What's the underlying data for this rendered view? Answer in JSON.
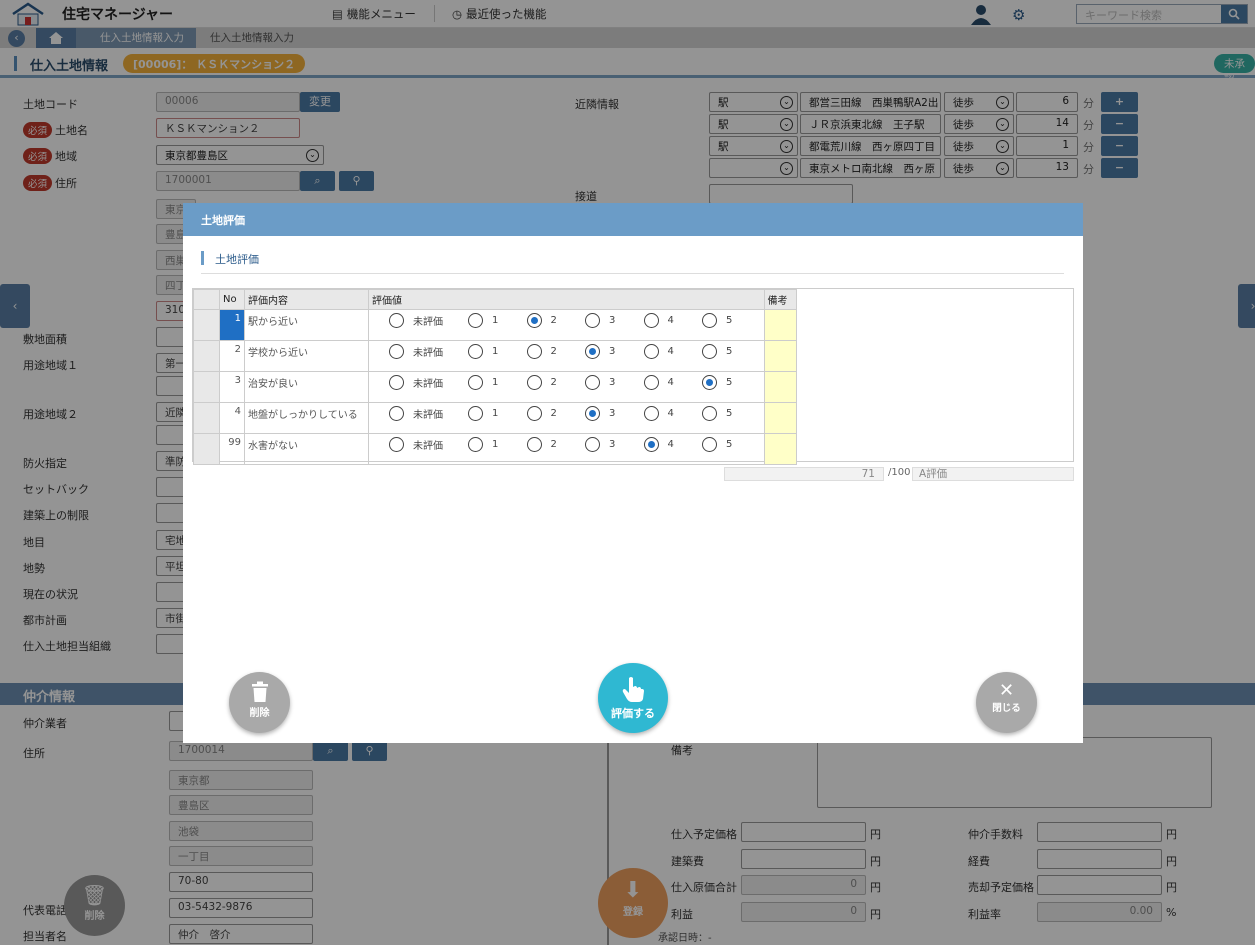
{
  "app": {
    "title": "住宅マネージャー",
    "menu_label": "機能メニュー",
    "recent_label": "最近使った機能",
    "search_placeholder": "キーワード検索"
  },
  "breadcrumb": {
    "items": [
      "仕入土地情報入力",
      "仕入土地情報入力"
    ]
  },
  "header": {
    "title": "仕入土地情報",
    "record_badge": "[00006]： ＫＳＫマンション２",
    "status_badge": "未承認"
  },
  "form": {
    "required_label": "必須",
    "land_code": {
      "label": "土地コード",
      "value": "00006",
      "button": "変更"
    },
    "land_name": {
      "label": "土地名",
      "value": "ＫＳＫマンション２"
    },
    "area": {
      "label": "地域",
      "value": "東京都豊島区"
    },
    "address": {
      "label": "住所",
      "postal": "1700001",
      "lines": [
        "東京",
        "豊島",
        "西巣",
        "四丁",
        "310"
      ]
    },
    "labels": [
      "敷地面積",
      "用途地域１",
      "用途地域２",
      "防火指定",
      "セットバック",
      "建築上の制限",
      "地目",
      "地勢",
      "現在の状況",
      "都市計画",
      "仕入土地担当組織"
    ],
    "partial_values": [
      "第一",
      "近隣",
      "準防",
      "宅地",
      "平坦",
      "市街"
    ],
    "nearby": {
      "label": "近隣情報",
      "rows": [
        {
          "type": "駅",
          "line": "都営三田線　西巣鴨駅A2出",
          "walk": "徒歩",
          "minutes": "6",
          "unit": "分",
          "btn": "+"
        },
        {
          "type": "駅",
          "line": "ＪＲ京浜東北線　王子駅",
          "walk": "徒歩",
          "minutes": "14",
          "unit": "分",
          "btn": "−"
        },
        {
          "type": "駅",
          "line": "都電荒川線　西ヶ原四丁目",
          "walk": "徒歩",
          "minutes": "1",
          "unit": "分",
          "btn": "−"
        },
        {
          "type": "",
          "line": "東京メトロ南北線　西ヶ原",
          "walk": "徒歩",
          "minutes": "13",
          "unit": "分",
          "btn": "−"
        }
      ]
    },
    "road_label": "接道"
  },
  "broker": {
    "section_title": "仲介情報",
    "broker_label": "仲介業者",
    "address_label": "住所",
    "postal": "1700014",
    "address_lines": [
      "東京都",
      "豊島区",
      "池袋",
      "一丁目"
    ],
    "address_number": "70-80",
    "phone_label": "代表電話番号",
    "phone": "03-5432-9876",
    "staff_label": "担当者名",
    "staff": "仲介　啓介",
    "memo_label": "備考",
    "price": {
      "purchase_label": "仕入予定価格",
      "construction_label": "建築費",
      "cost_total_label": "仕入原価合計",
      "profit_label": "利益",
      "fee_label": "仲介手数料",
      "expense_label": "経費",
      "sale_label": "売却予定価格",
      "rate_label": "利益率",
      "cost_total": "0",
      "profit": "0",
      "rate": "0.00",
      "yen": "円",
      "percent": "%"
    },
    "approved_label": "承認日時：-",
    "delete_label": "削除",
    "register_label": "登録"
  },
  "modal": {
    "title": "土地評価",
    "subtitle": "土地評価",
    "columns": [
      "No",
      "評価内容",
      "評価値",
      "備考"
    ],
    "options": [
      "未評価",
      "1",
      "2",
      "3",
      "4",
      "5"
    ],
    "rows": [
      {
        "no": "1",
        "content": "駅から近い",
        "selected": 2
      },
      {
        "no": "2",
        "content": "学校から近い",
        "selected": 3
      },
      {
        "no": "3",
        "content": "治安が良い",
        "selected": 5
      },
      {
        "no": "4",
        "content": "地盤がしっかりしている",
        "selected": 3
      },
      {
        "no": "99",
        "content": "水害がない",
        "selected": 4
      }
    ],
    "score": "71",
    "score_max": "/100",
    "grade": "A評価",
    "delete_label": "削除",
    "evaluate_label": "評価する",
    "close_label": "閉じる"
  },
  "colors": {
    "accent": "#6b9cc7",
    "fab_teal": "#2fb8d2",
    "fab_gray": "#a9a9a9",
    "required": "#c0392b",
    "radio_on": "#1f6fc4"
  }
}
